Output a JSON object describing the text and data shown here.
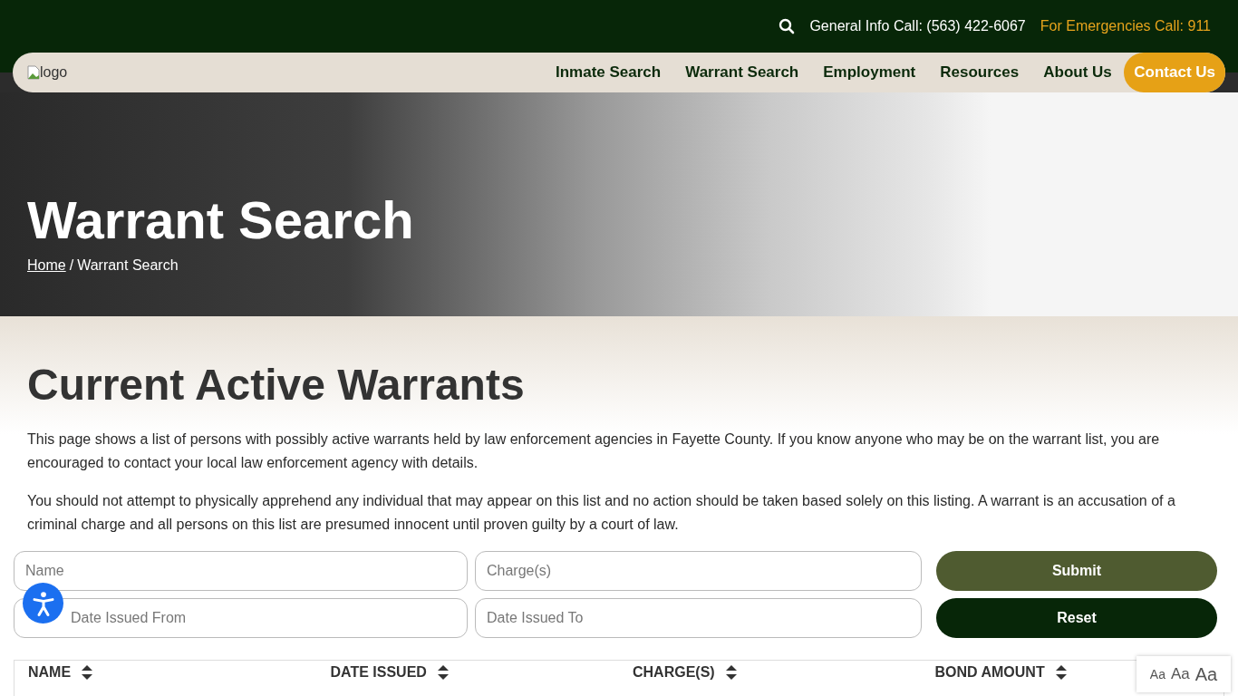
{
  "topbar": {
    "general": "General Info Call: (563) 422-6067",
    "emergency": "For Emergencies Call: 911"
  },
  "logo_alt": "logo",
  "nav": [
    {
      "label": "Inmate Search",
      "kind": "link"
    },
    {
      "label": "Warrant Search",
      "kind": "link"
    },
    {
      "label": "Employment",
      "kind": "link"
    },
    {
      "label": "Resources",
      "kind": "link"
    },
    {
      "label": "About Us",
      "kind": "link"
    },
    {
      "label": "Contact Us",
      "kind": "cta"
    }
  ],
  "hero": {
    "title": "Warrant Search",
    "breadcrumb": [
      {
        "label": "Home",
        "kind": "link"
      },
      {
        "label": "/",
        "kind": "separator"
      },
      {
        "label": "Warrant Search",
        "kind": "current"
      }
    ]
  },
  "heading": "Current Active Warrants",
  "paragraphs": [
    "This page shows a list of persons with possibly active warrants held by law enforcement agencies in Fayette County. If you know anyone who may be on the warrant list, you are encouraged to contact your local law enforcement agency with details.",
    "You should not attempt to physically apprehend any individual that may appear on this list and no action should be taken based solely on this listing. A warrant is an accusation of a criminal charge and all persons on this list are presumed innocent until proven guilty by a court of law."
  ],
  "form": {
    "fields": [
      {
        "placeholder": "Name"
      },
      {
        "placeholder": "Charge(s)"
      },
      {
        "placeholder": "Date Issued From"
      },
      {
        "placeholder": "Date Issued To"
      }
    ],
    "submit": "Submit",
    "reset": "Reset"
  },
  "table": {
    "columns": [
      "NAME",
      "DATE ISSUED",
      "CHARGE(S)",
      "BOND AMOUNT"
    ]
  },
  "font_sizes": [
    "Aa",
    "Aa",
    "Aa"
  ]
}
